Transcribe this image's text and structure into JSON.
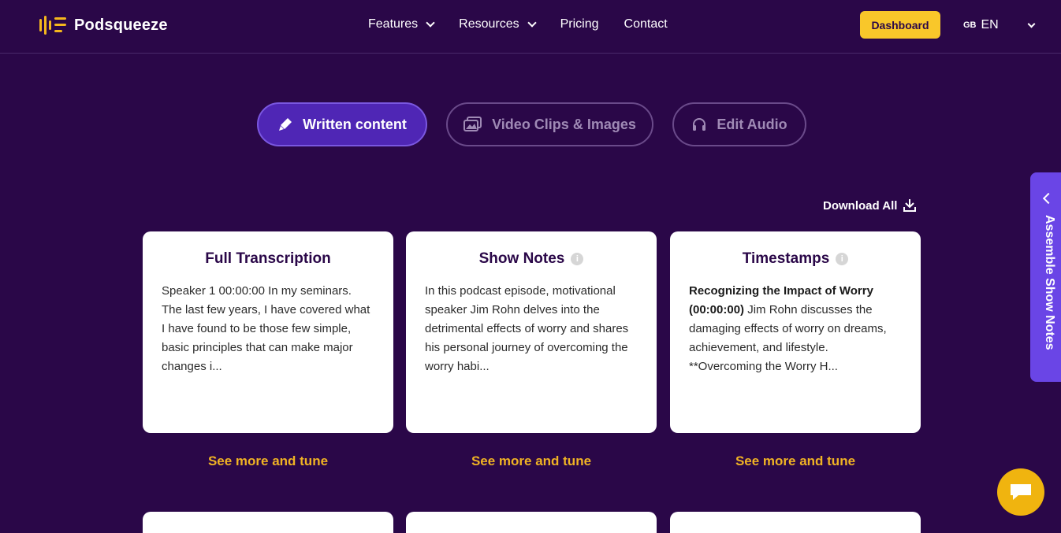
{
  "header": {
    "brand": "Podsqueeze",
    "nav": [
      {
        "label": "Features",
        "has_dropdown": true
      },
      {
        "label": "Resources",
        "has_dropdown": true
      },
      {
        "label": "Pricing",
        "has_dropdown": false
      },
      {
        "label": "Contact",
        "has_dropdown": false
      }
    ],
    "dashboard_label": "Dashboard",
    "lang_flag": "GB",
    "lang_code": "EN"
  },
  "tabs": [
    {
      "label": "Written content",
      "icon": "pen-icon",
      "active": true
    },
    {
      "label": "Video Clips & Images",
      "icon": "images-icon",
      "active": false
    },
    {
      "label": "Edit Audio",
      "icon": "headphones-icon",
      "active": false
    }
  ],
  "download_all_label": "Download All",
  "cards": [
    {
      "title": "Full Transcription",
      "has_info": false,
      "bold_prefix": "",
      "body": "Speaker 1 00:00:00 In my seminars. The last few years, I have covered what I have found to be those few simple, basic principles that can make major changes i...",
      "see_more": "See more and tune"
    },
    {
      "title": "Show Notes",
      "has_info": true,
      "bold_prefix": "",
      "body": "In this podcast episode, motivational speaker Jim Rohn delves into the detrimental effects of worry and shares his personal journey of overcoming the worry habi...",
      "see_more": "See more and tune"
    },
    {
      "title": "Timestamps",
      "has_info": true,
      "bold_prefix": "Recognizing the Impact of Worry (00:00:00)",
      "body": " Jim Rohn discusses the damaging effects of worry on dreams, achievement, and lifestyle. **Overcoming the Worry H...",
      "see_more": "See more and tune"
    }
  ],
  "side_panel_label": "Assemble Show Notes",
  "colors": {
    "background": "#2a0748",
    "accent_yellow": "#f9c72a",
    "active_tab": "#4f26b5",
    "side_tab": "#6a45e6"
  }
}
